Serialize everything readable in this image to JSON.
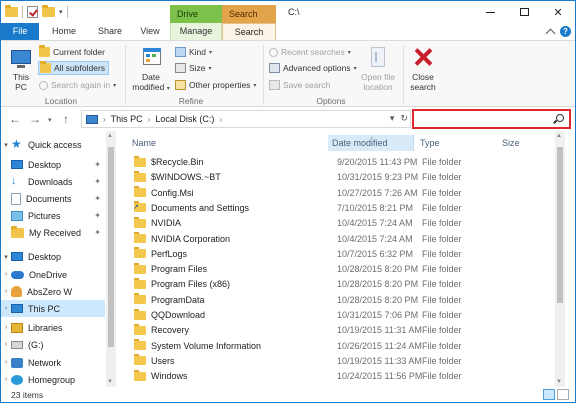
{
  "title": "C:\\",
  "context_tabs": {
    "drive_tools": "Drive Tools",
    "search_tools": "Search Tools"
  },
  "ribbon_tabs": {
    "file": "File",
    "home": "Home",
    "share": "Share",
    "view": "View",
    "manage": "Manage",
    "search": "Search"
  },
  "ribbon": {
    "location": {
      "this_pc": "This PC",
      "current_folder": "Current folder",
      "all_subfolders": "All subfolders",
      "search_again_in": "Search again in",
      "label": "Location"
    },
    "refine": {
      "date_modified": "Date",
      "date_modified_2": "modified",
      "kind": "Kind",
      "size": "Size",
      "other_properties": "Other properties",
      "label": "Refine"
    },
    "options": {
      "recent_searches": "Recent searches",
      "advanced_options": "Advanced options",
      "save_search": "Save search",
      "open_file_location": "Open file",
      "open_file_location_2": "location",
      "label": "Options"
    },
    "close_search": "Close",
    "close_search_2": "search"
  },
  "address": {
    "segments": [
      "This PC",
      "Local Disk (C:)"
    ]
  },
  "search": {
    "value": "",
    "placeholder": ""
  },
  "nav": {
    "quick_access": "Quick access",
    "items": [
      {
        "label": "Desktop",
        "icon": "desktop-icon",
        "pinned": true
      },
      {
        "label": "Downloads",
        "icon": "downloads-icon",
        "pinned": true
      },
      {
        "label": "Documents",
        "icon": "documents-icon",
        "pinned": true
      },
      {
        "label": "Pictures",
        "icon": "pictures-icon",
        "pinned": true
      },
      {
        "label": "My Received",
        "icon": "folder-icon",
        "pinned": true
      }
    ],
    "desktop": "Desktop",
    "onedrive": "OneDrive",
    "abszero": "AbsZero W",
    "this_pc": "This PC",
    "libraries": "Libraries",
    "g_drive": "(G:)",
    "network": "Network",
    "homegroup": "Homegroup"
  },
  "columns": {
    "name": "Name",
    "date_modified": "Date modified",
    "type": "Type",
    "size": "Size"
  },
  "files": [
    {
      "name": "$Recycle.Bin",
      "date": "9/20/2015 11:43 PM",
      "type": "File folder"
    },
    {
      "name": "$WINDOWS.~BT",
      "date": "10/31/2015 9:23 PM",
      "type": "File folder"
    },
    {
      "name": "Config.Msi",
      "date": "10/27/2015 7:26 AM",
      "type": "File folder"
    },
    {
      "name": "Documents and Settings",
      "date": "7/10/2015 8:21 PM",
      "type": "File folder",
      "shortcut": true
    },
    {
      "name": "NVIDIA",
      "date": "10/4/2015 7:24 AM",
      "type": "File folder"
    },
    {
      "name": "NVIDIA Corporation",
      "date": "10/4/2015 7:24 AM",
      "type": "File folder"
    },
    {
      "name": "PerfLogs",
      "date": "10/7/2015 6:32 PM",
      "type": "File folder"
    },
    {
      "name": "Program Files",
      "date": "10/28/2015 8:20 PM",
      "type": "File folder"
    },
    {
      "name": "Program Files (x86)",
      "date": "10/28/2015 8:20 PM",
      "type": "File folder"
    },
    {
      "name": "ProgramData",
      "date": "10/28/2015 8:20 PM",
      "type": "File folder"
    },
    {
      "name": "QQDownload",
      "date": "10/31/2015 7:06 PM",
      "type": "File folder"
    },
    {
      "name": "Recovery",
      "date": "10/19/2015 11:31 AM",
      "type": "File folder"
    },
    {
      "name": "System Volume Information",
      "date": "10/26/2015 11:24 AM",
      "type": "File folder"
    },
    {
      "name": "Users",
      "date": "10/19/2015 11:33 AM",
      "type": "File folder"
    },
    {
      "name": "Windows",
      "date": "10/24/2015 11:56 PM",
      "type": "File folder"
    }
  ],
  "status": {
    "count": "23 items"
  },
  "colors": {
    "accent": "#1979ca",
    "drive_tools": "#7bc14a",
    "search_tools": "#e3a34a",
    "highlight": "#e0262e"
  }
}
